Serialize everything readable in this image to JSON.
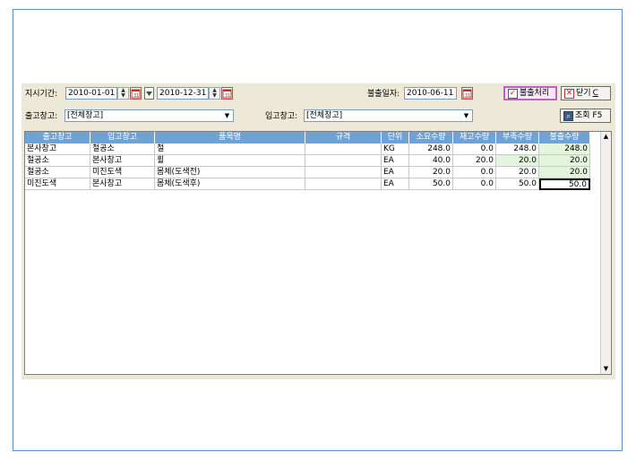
{
  "toolbar": {
    "period_label": "지시기간:",
    "date_from": "2010-01-01",
    "date_to": "2010-12-31",
    "issue_date_label": "불출일자:",
    "issue_date": "2010-06-11",
    "process_button": "불출처리",
    "close_button": "닫기",
    "close_hotkey": "C"
  },
  "filters": {
    "out_warehouse_label": "출고창고:",
    "out_warehouse_value": "[전체창고]",
    "in_warehouse_label": "입고창고:",
    "in_warehouse_value": "[전체창고]",
    "search_button": "조회 F5"
  },
  "table": {
    "columns": [
      "출고창고",
      "입고창고",
      "품목명",
      "규격",
      "단위",
      "소요수량",
      "재고수량",
      "부족수량",
      "불출수량"
    ],
    "rows": [
      {
        "out": "본사창고",
        "in": "철공소",
        "item": "철",
        "spec": "",
        "unit": "KG",
        "req": "248.0",
        "stock": "0.0",
        "short": "248.0",
        "issue": "248.0"
      },
      {
        "out": "철공소",
        "in": "본사창고",
        "item": "휠",
        "spec": "",
        "unit": "EA",
        "req": "40.0",
        "stock": "20.0",
        "short": "20.0",
        "issue": "20.0"
      },
      {
        "out": "철공소",
        "in": "미진도색",
        "item": "몸체(도색전)",
        "spec": "",
        "unit": "EA",
        "req": "20.0",
        "stock": "0.0",
        "short": "20.0",
        "issue": "20.0"
      },
      {
        "out": "미진도색",
        "in": "본사창고",
        "item": "몸체(도색후)",
        "spec": "",
        "unit": "EA",
        "req": "50.0",
        "stock": "0.0",
        "short": "50.0",
        "issue": "50.0"
      }
    ]
  },
  "colors": {
    "header_bg": "#6ea3d8",
    "highlight_green": "#e3f5dd",
    "frame_border": "#5b8fc4"
  }
}
